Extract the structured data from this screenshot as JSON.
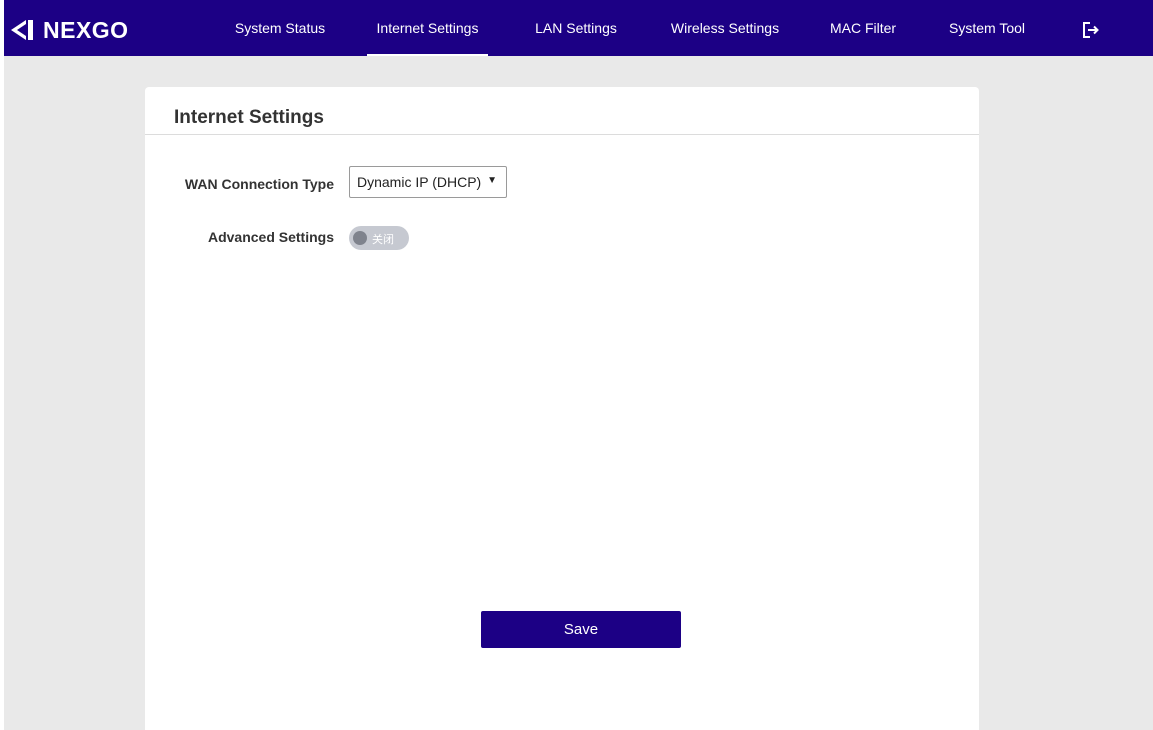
{
  "brand": {
    "logo_text": "NEXGO",
    "color_primary": "#1c0085",
    "color_background": "#e9e9e9"
  },
  "nav": {
    "items": [
      {
        "label": "System Status"
      },
      {
        "label": "Internet Settings",
        "active": true
      },
      {
        "label": "LAN Settings"
      },
      {
        "label": "Wireless Settings"
      },
      {
        "label": "MAC Filter"
      },
      {
        "label": "System Tool"
      }
    ],
    "logout_icon": "logout-icon"
  },
  "panel": {
    "title": "Internet Settings",
    "wan_connection_type": {
      "label": "WAN Connection Type",
      "selected": "Dynamic IP (DHCP)"
    },
    "advanced_settings": {
      "label": "Advanced Settings",
      "toggle_text": "关闭",
      "enabled": false
    },
    "save_label": "Save"
  }
}
